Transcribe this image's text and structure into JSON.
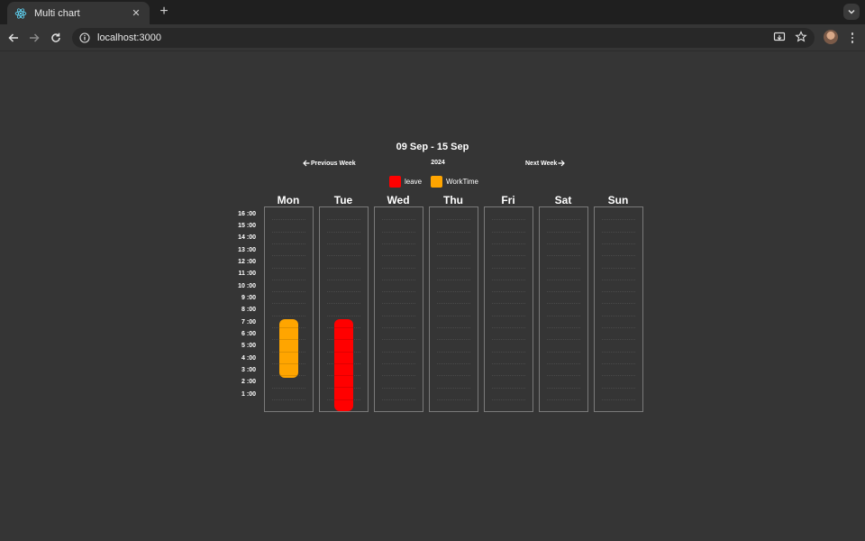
{
  "browser": {
    "tab_title": "Multi chart",
    "tab_close": "✕",
    "new_tab": "+",
    "url": "localhost:3000"
  },
  "calendar": {
    "title": "09 Sep - 15 Sep",
    "prev_label": "Previous Week",
    "next_label": "Next Week",
    "year": "2024",
    "legend": [
      {
        "label": "leave",
        "color": "#ff0000"
      },
      {
        "label": "WorkTime",
        "color": "#ffa500"
      }
    ],
    "days": [
      "Mon",
      "Tue",
      "Wed",
      "Thu",
      "Fri",
      "Sat",
      "Sun"
    ],
    "hours": [
      "16 :00",
      "15 :00",
      "14 :00",
      "13 :00",
      "12 :00",
      "11 :00",
      "10 :00",
      "9 :00",
      "8 :00",
      "7 :00",
      "6 :00",
      "5 :00",
      "4 :00",
      "3 :00",
      "2 :00",
      "1 :00"
    ],
    "events": [
      {
        "day": "Mon",
        "type": "WorkTime",
        "start_hour": 2.8,
        "end_hour": 7.7,
        "color": "#ffa500"
      },
      {
        "day": "Tue",
        "type": "leave",
        "start_hour": 0,
        "end_hour": 7.7,
        "color": "#ff0000"
      }
    ]
  }
}
